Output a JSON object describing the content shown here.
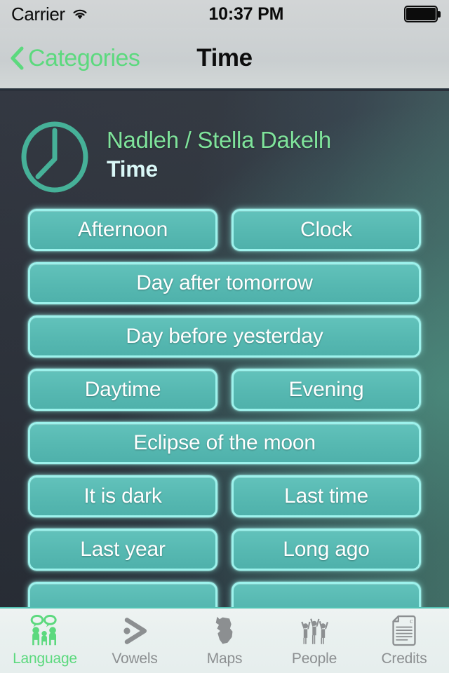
{
  "statusbar": {
    "carrier": "Carrier",
    "wifi_icon": "wifi-icon",
    "time": "10:37 PM",
    "battery_icon": "battery-full-icon"
  },
  "navbar": {
    "back_icon": "chevron-left-icon",
    "back_label": "Categories",
    "title": "Time",
    "accent_color": "#5cd97e"
  },
  "header": {
    "icon": "clock-icon",
    "language": "Nadleh / Stella Dakelh",
    "category": "Time"
  },
  "buttons": {
    "rows": [
      {
        "items": [
          {
            "label": "Afternoon"
          },
          {
            "label": "Clock"
          }
        ]
      },
      {
        "items": [
          {
            "label": "Day after tomorrow"
          }
        ]
      },
      {
        "items": [
          {
            "label": "Day before yesterday"
          }
        ]
      },
      {
        "items": [
          {
            "label": "Daytime"
          },
          {
            "label": "Evening"
          }
        ]
      },
      {
        "items": [
          {
            "label": "Eclipse of the moon"
          }
        ]
      },
      {
        "items": [
          {
            "label": "It is dark"
          },
          {
            "label": "Last time"
          }
        ]
      },
      {
        "items": [
          {
            "label": "Last year"
          },
          {
            "label": "Long ago"
          }
        ]
      },
      {
        "items": [
          {
            "label": ""
          },
          {
            "label": ""
          }
        ]
      }
    ],
    "fill_color": "#57b9b2",
    "border_color": "#9df2ec",
    "text_color": "#ffffff"
  },
  "tabbar": {
    "active_color": "#5cd97e",
    "inactive_color": "#8c8f91",
    "tabs": [
      {
        "label": "Language",
        "icon": "people-speaking-icon",
        "active": true
      },
      {
        "label": "Vowels",
        "icon": "vowel-arrow-icon",
        "active": false
      },
      {
        "label": "Maps",
        "icon": "map-region-icon",
        "active": false
      },
      {
        "label": "People",
        "icon": "people-raised-arms-icon",
        "active": false
      },
      {
        "label": "Credits",
        "icon": "document-credits-icon",
        "active": false
      }
    ]
  }
}
